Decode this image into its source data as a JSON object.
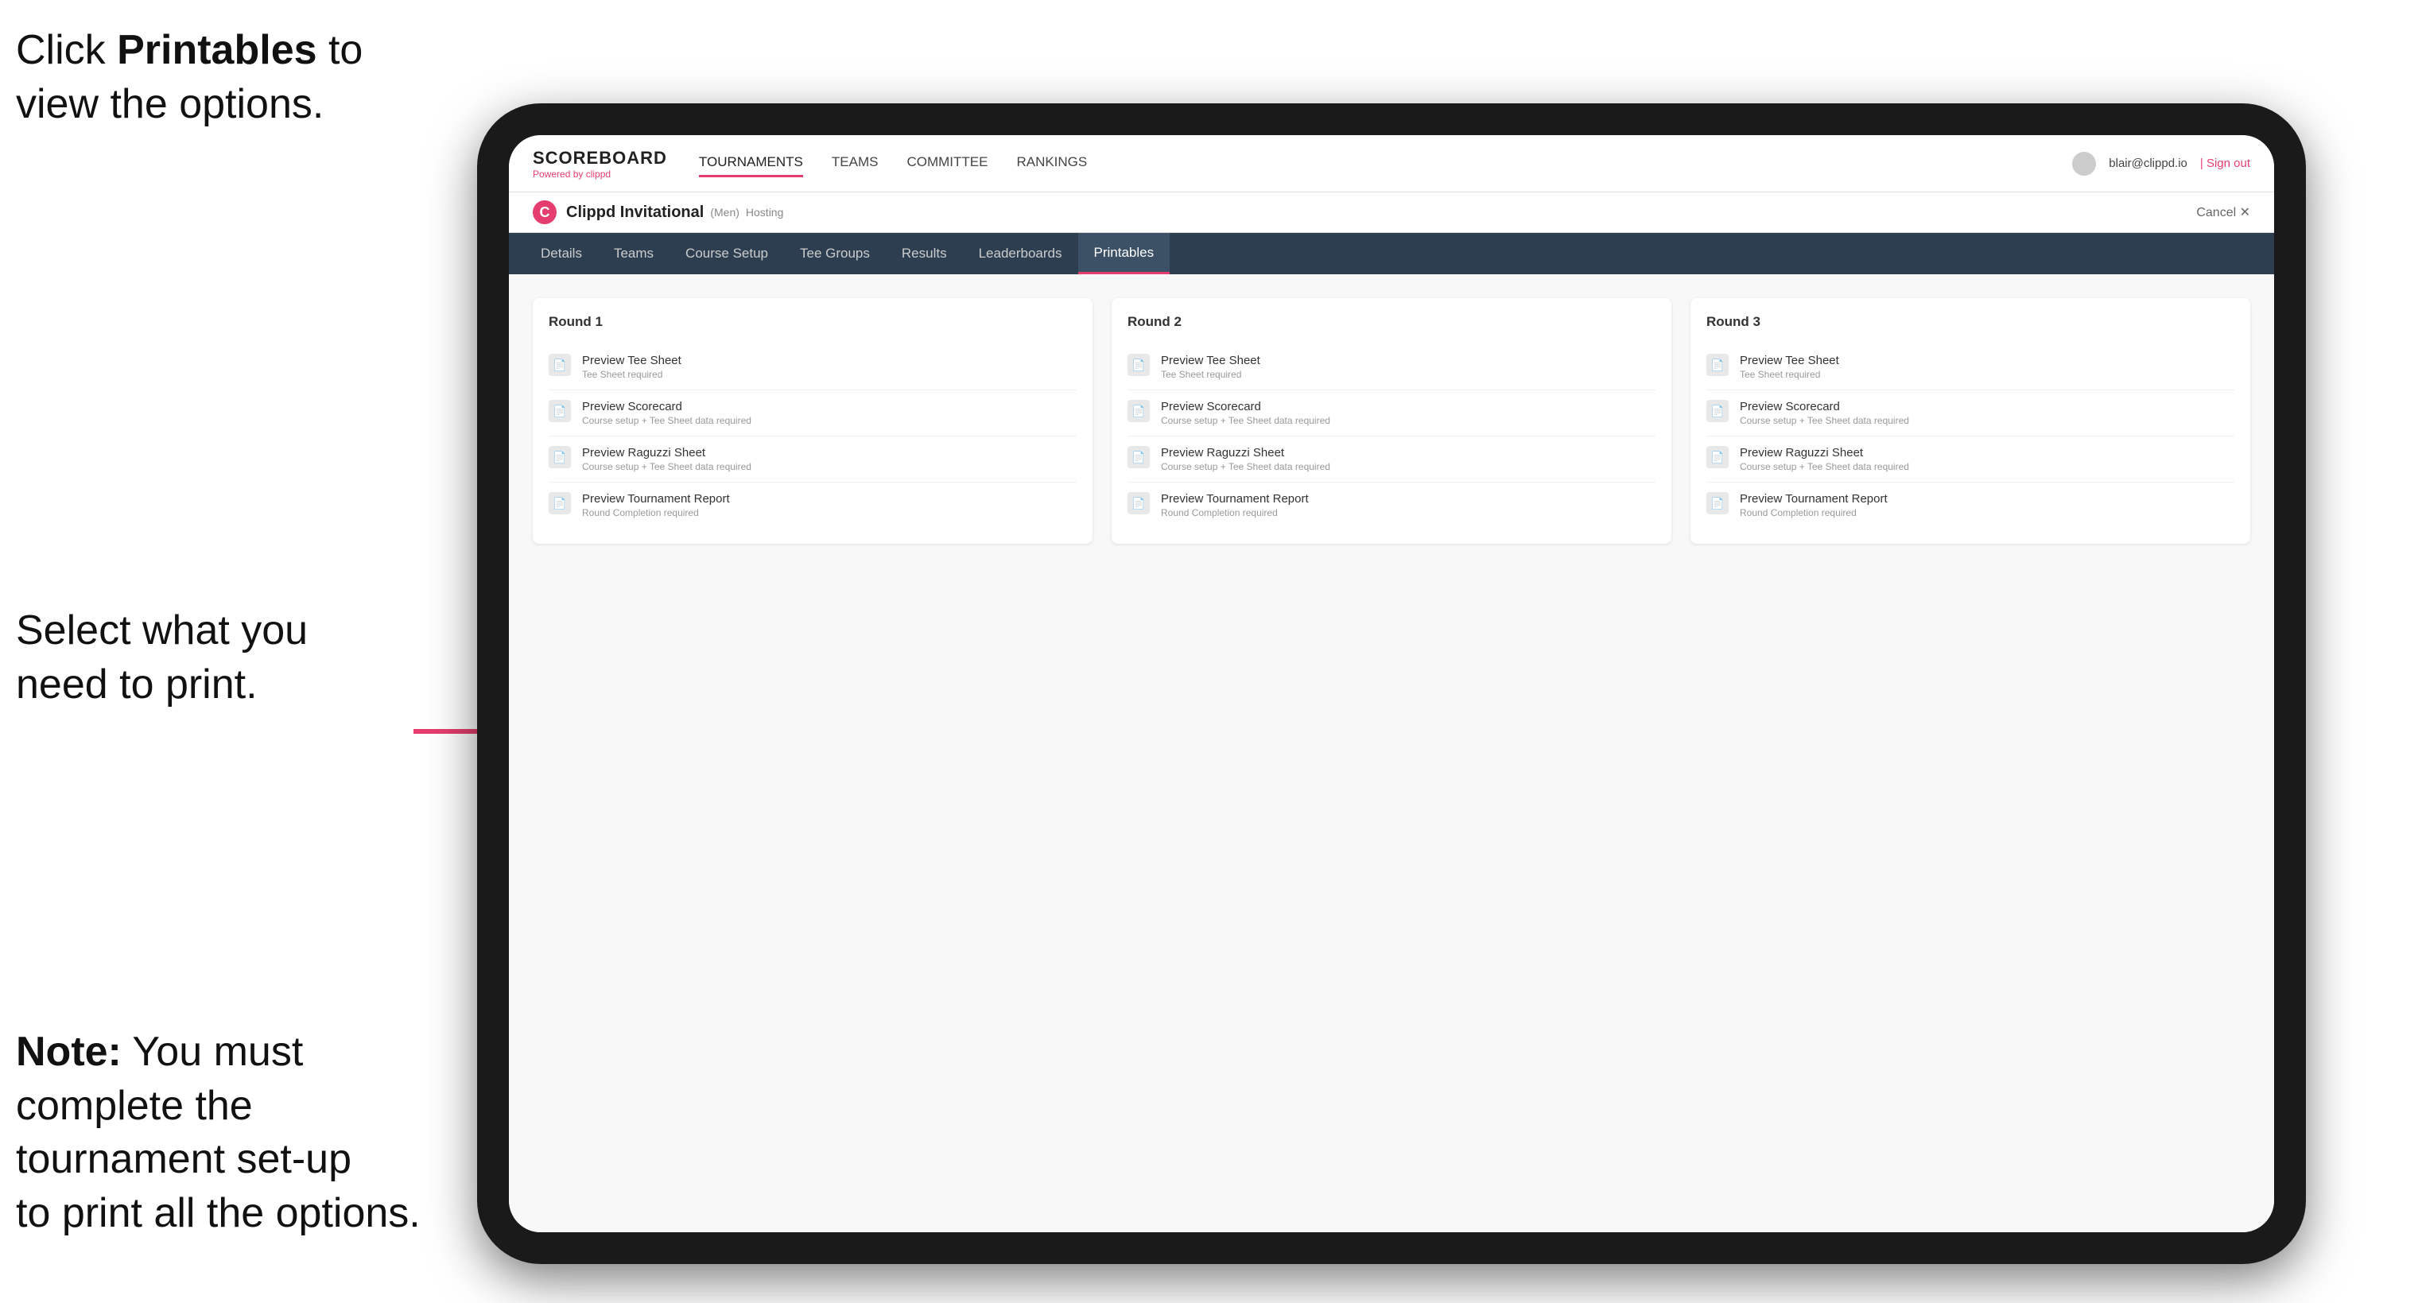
{
  "annotations": {
    "top_text_part1": "Click ",
    "top_text_bold": "Printables",
    "top_text_part2": " to view the options.",
    "mid_text": "Select what you need to print.",
    "bottom_text_bold": "Note:",
    "bottom_text": " You must complete the tournament set-up to print all the options."
  },
  "nav": {
    "brand": "SCOREBOARD",
    "brand_sub": "Powered by clippd",
    "links": [
      "TOURNAMENTS",
      "TEAMS",
      "COMMITTEE",
      "RANKINGS"
    ],
    "active_link": "TOURNAMENTS",
    "user_email": "blair@clippd.io",
    "sign_out": "Sign out"
  },
  "sub_header": {
    "logo_letter": "C",
    "title": "Clippd Invitational",
    "badge": "(Men)",
    "status": "Hosting",
    "cancel": "Cancel ✕"
  },
  "tabs": [
    "Details",
    "Teams",
    "Course Setup",
    "Tee Groups",
    "Results",
    "Leaderboards",
    "Printables"
  ],
  "active_tab": "Printables",
  "rounds": [
    {
      "title": "Round 1",
      "items": [
        {
          "name": "Preview Tee Sheet",
          "req": "Tee Sheet required"
        },
        {
          "name": "Preview Scorecard",
          "req": "Course setup + Tee Sheet data required"
        },
        {
          "name": "Preview Raguzzi Sheet",
          "req": "Course setup + Tee Sheet data required"
        },
        {
          "name": "Preview Tournament Report",
          "req": "Round Completion required"
        }
      ]
    },
    {
      "title": "Round 2",
      "items": [
        {
          "name": "Preview Tee Sheet",
          "req": "Tee Sheet required"
        },
        {
          "name": "Preview Scorecard",
          "req": "Course setup + Tee Sheet data required"
        },
        {
          "name": "Preview Raguzzi Sheet",
          "req": "Course setup + Tee Sheet data required"
        },
        {
          "name": "Preview Tournament Report",
          "req": "Round Completion required"
        }
      ]
    },
    {
      "title": "Round 3",
      "items": [
        {
          "name": "Preview Tee Sheet",
          "req": "Tee Sheet required"
        },
        {
          "name": "Preview Scorecard",
          "req": "Course setup + Tee Sheet data required"
        },
        {
          "name": "Preview Raguzzi Sheet",
          "req": "Course setup + Tee Sheet data required"
        },
        {
          "name": "Preview Tournament Report",
          "req": "Round Completion required"
        }
      ]
    }
  ]
}
